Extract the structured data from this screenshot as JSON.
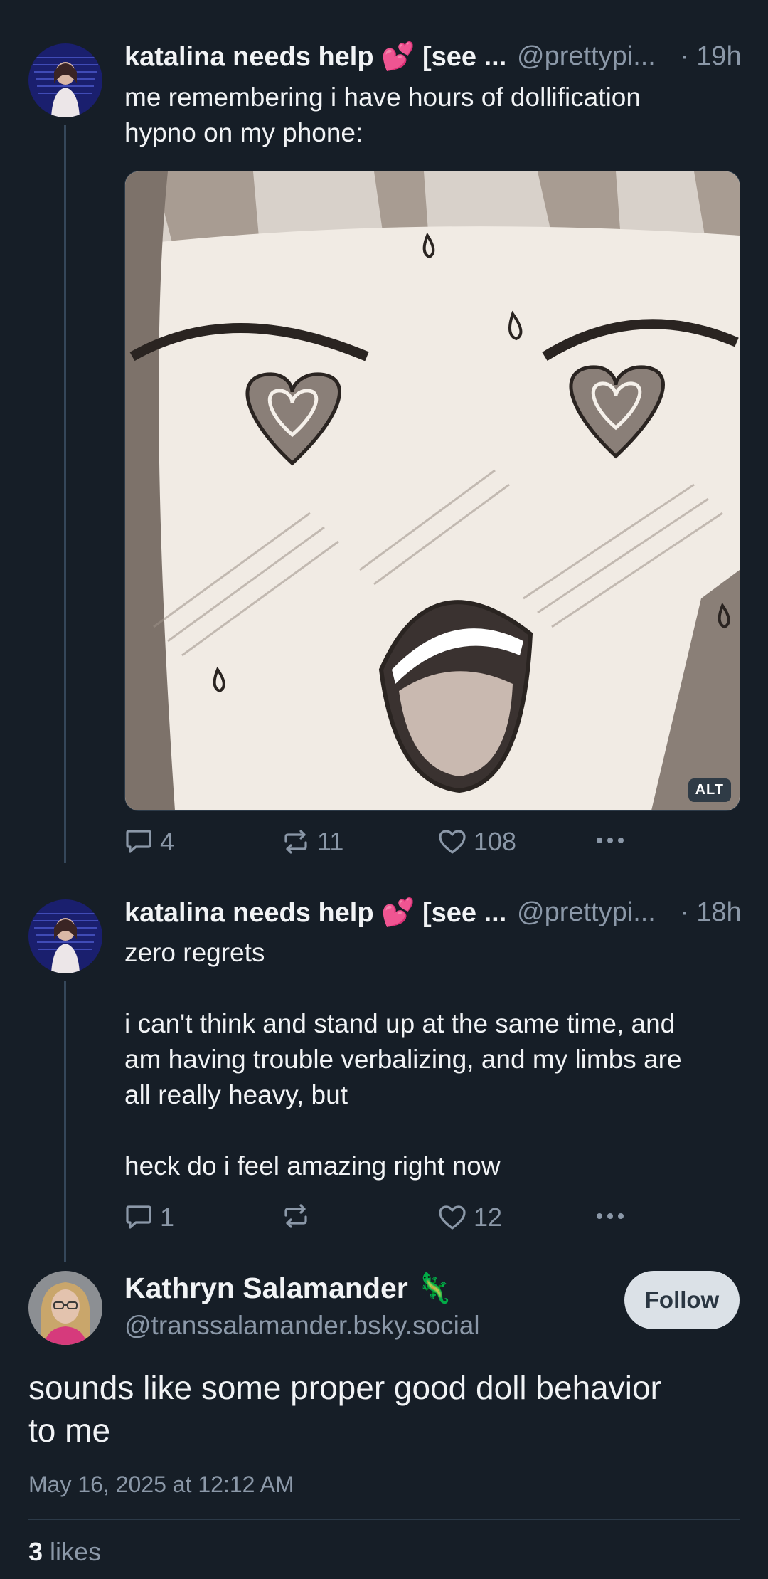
{
  "posts": [
    {
      "author_name": "katalina needs help 💕 [see ...",
      "handle": "@prettypi...",
      "time": "· 19h",
      "text": "me remembering i have hours of dollification\nhypno on my phone:",
      "media_alt_badge": "ALT",
      "replies": "4",
      "reposts": "11",
      "likes": "108"
    },
    {
      "author_name": "katalina needs help 💕 [see ...",
      "handle": "@prettypi...",
      "time": "· 18h",
      "text": "zero regrets\n\ni can't think and stand up at the same time, and\nam having trouble verbalizing, and my limbs are\nall really heavy, but\n\nheck do i feel amazing right now",
      "replies": "1",
      "reposts": "",
      "likes": "12"
    }
  ],
  "focused_post": {
    "author_name": "Kathryn Salamander 🦎",
    "handle": "@transsalamander.bsky.social",
    "follow_label": "Follow",
    "text": "sounds like some proper good doll behavior\nto me",
    "timestamp": "May 16, 2025 at 12:12 AM",
    "likes_count": "3",
    "likes_label": "likes"
  },
  "colors": {
    "background": "#161e27",
    "secondary_text": "#8b98a8",
    "thread_line": "#35475a"
  }
}
